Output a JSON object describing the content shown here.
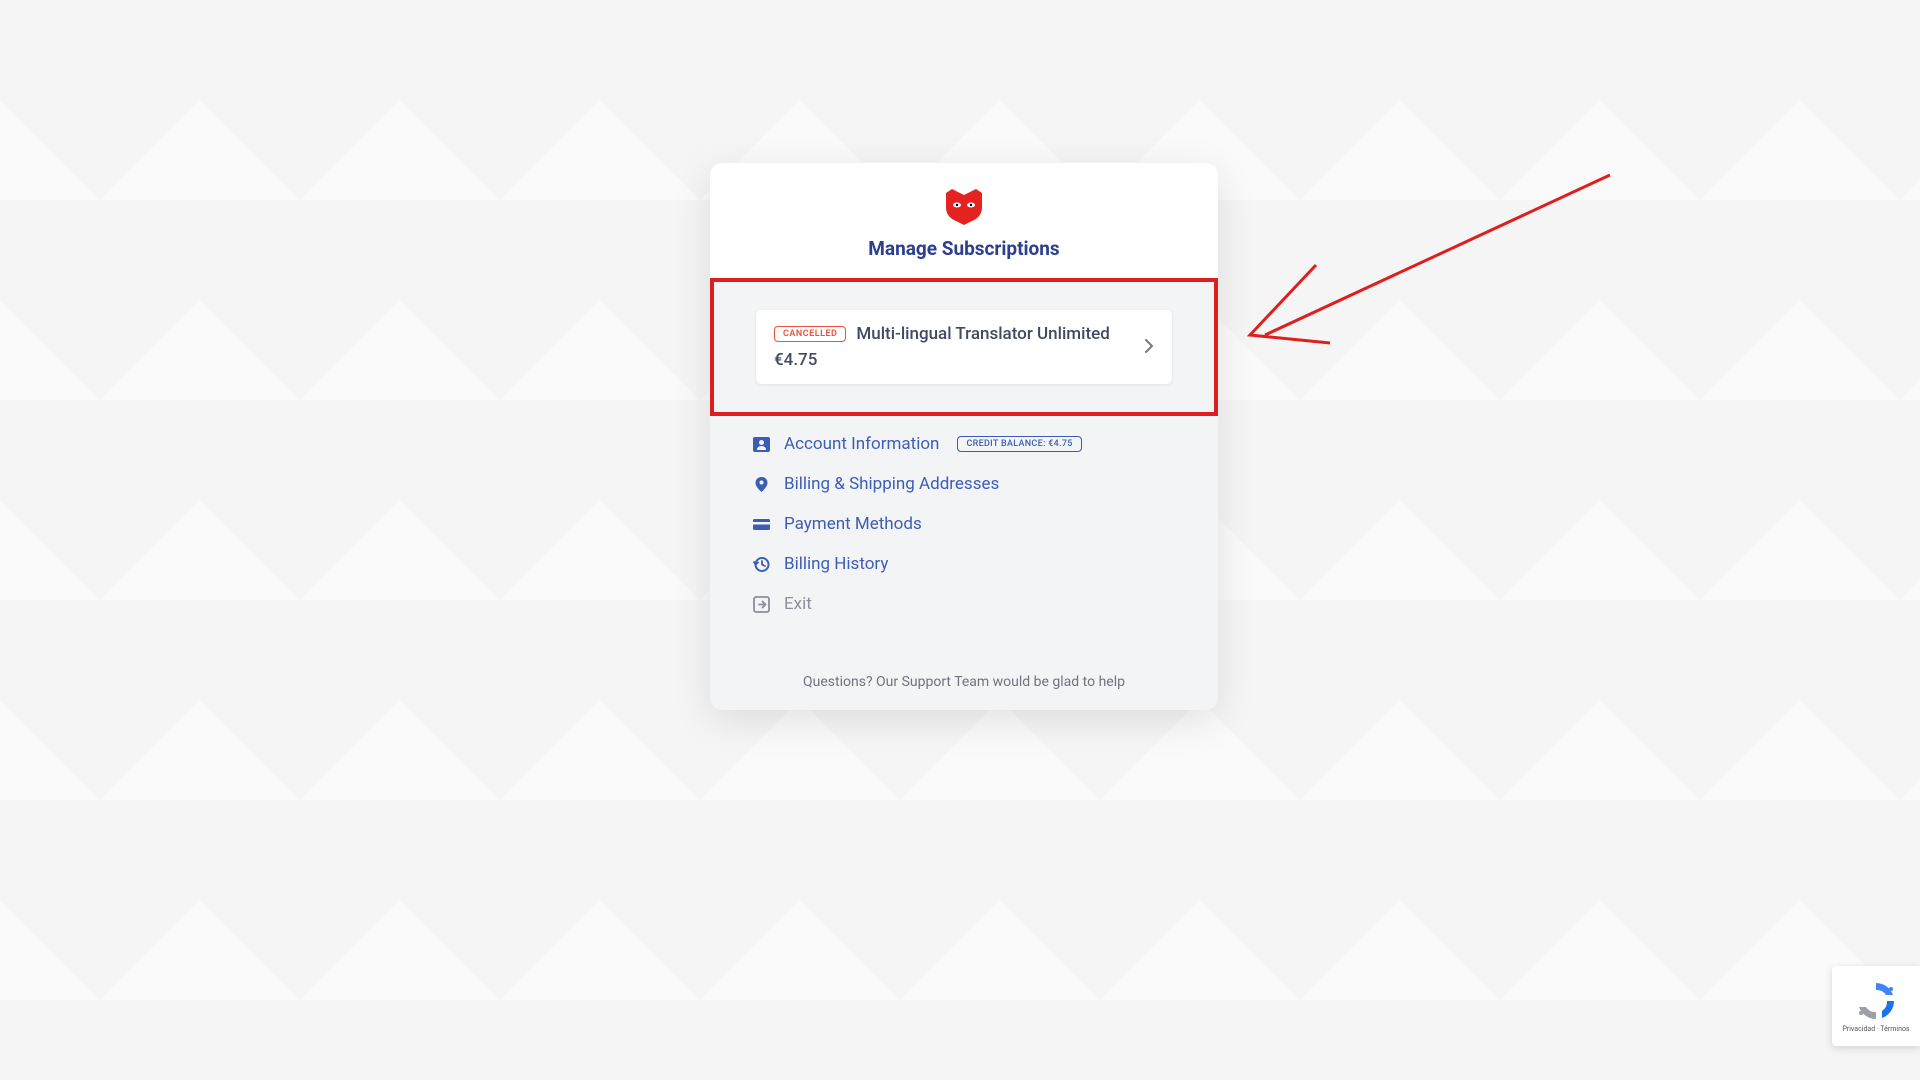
{
  "header": {
    "title": "Manage Subscriptions"
  },
  "subscription": {
    "status_badge": "CANCELLED",
    "name": "Multi-lingual Translator Unlimited",
    "price": "€4.75"
  },
  "menu": {
    "account_info": {
      "label": "Account Information",
      "credit_badge": "CREDIT BALANCE: €4.75"
    },
    "addresses": {
      "label": "Billing & Shipping Addresses"
    },
    "payment": {
      "label": "Payment Methods"
    },
    "history": {
      "label": "Billing History"
    },
    "exit": {
      "label": "Exit"
    }
  },
  "footer": {
    "support_text": "Questions? Our Support Team would be glad to help"
  },
  "recaptcha": {
    "label": "Privacidad · Términos"
  },
  "colors": {
    "accent_blue": "#3d5db5",
    "title_blue": "#2b3e8f",
    "red_highlight": "#de1f1f",
    "red_logo": "#e42320",
    "cancelled_red": "#ee4f3e"
  }
}
